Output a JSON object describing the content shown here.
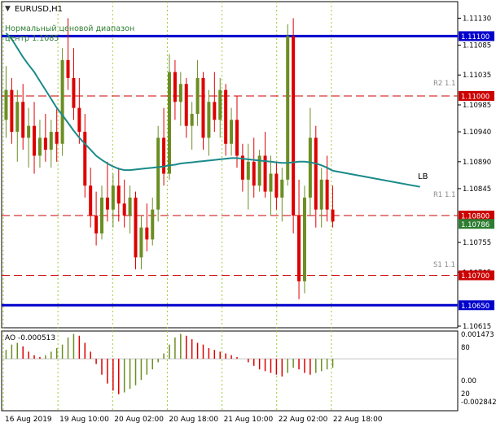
{
  "header": {
    "symbol_label": "EURUSD,H1",
    "indicator_name": "Нормальный ценовой диапазон",
    "indicator_detail": "центр 1.1085"
  },
  "right_scale": {
    "ticks": [
      "1.11130",
      "1.11085",
      "1.11035",
      "1.10985",
      "1.10940",
      "1.10890",
      "1.10845",
      "1.10755",
      "1.10705",
      "1.10615"
    ],
    "badges": [
      {
        "text": "1.11100",
        "color": "#0000cc"
      },
      {
        "text": "1.11000",
        "color": "#cc0000"
      },
      {
        "text": "1.10800",
        "color": "#cc0000"
      },
      {
        "text": "1.10786",
        "color": "#2e7d32"
      },
      {
        "text": "1.10700",
        "color": "#cc0000"
      },
      {
        "text": "1.10650",
        "color": "#0000cc"
      }
    ]
  },
  "pivot_labels": {
    "r2": "R2 1.1",
    "r1": "R1 1.1",
    "s1": "S1 1.1"
  },
  "lb_label": "LB",
  "ao_panel": {
    "label": "AO -0.000513",
    "scale_top": "0.001473",
    "scale_bottom": "-0.002842",
    "level_80": "80",
    "level_20": "20",
    "level_0": "0.00"
  },
  "time_axis": [
    "16 Aug 2019",
    "19 Aug 10:00",
    "20 Aug 02:00",
    "20 Aug 18:00",
    "21 Aug 10:00",
    "22 Aug 02:00",
    "22 Aug 18:00"
  ],
  "colors": {
    "bull": "#6b8e23",
    "bear": "#dd0000",
    "ma": "#1a8a8a",
    "level_blue": "#0000cc",
    "level_red": "#cc0000"
  },
  "chart_data": {
    "type": "candlestick",
    "symbol": "EURUSD",
    "timeframe": "H1",
    "ylim": [
      1.10615,
      1.11155
    ],
    "horizontal_levels": [
      1.111,
      1.11,
      1.108,
      1.107,
      1.1065
    ],
    "candles": [
      [
        1.1096,
        1.1105,
        1.1093,
        1.1101
      ],
      [
        1.1101,
        1.1103,
        1.1092,
        1.1094
      ],
      [
        1.1094,
        1.1101,
        1.1089,
        1.1099
      ],
      [
        1.1099,
        1.1102,
        1.1091,
        1.1093
      ],
      [
        1.1093,
        1.1098,
        1.1088,
        1.1095
      ],
      [
        1.1095,
        1.1099,
        1.1087,
        1.109
      ],
      [
        1.109,
        1.1096,
        1.1088,
        1.1093
      ],
      [
        1.1093,
        1.1097,
        1.1089,
        1.1091
      ],
      [
        1.1091,
        1.1096,
        1.1088,
        1.1094
      ],
      [
        1.1094,
        1.1098,
        1.1089,
        1.1092
      ],
      [
        1.1092,
        1.1108,
        1.109,
        1.1106
      ],
      [
        1.1106,
        1.1113,
        1.1101,
        1.1103
      ],
      [
        1.1103,
        1.1108,
        1.1096,
        1.1098
      ],
      [
        1.1098,
        1.1103,
        1.1092,
        1.1094
      ],
      [
        1.1094,
        1.1097,
        1.1083,
        1.1085
      ],
      [
        1.1085,
        1.1088,
        1.1078,
        1.108
      ],
      [
        1.108,
        1.1084,
        1.1075,
        1.1077
      ],
      [
        1.1077,
        1.1085,
        1.1076,
        1.1083
      ],
      [
        1.1083,
        1.1089,
        1.1079,
        1.1081
      ],
      [
        1.1081,
        1.1087,
        1.1078,
        1.1085
      ],
      [
        1.1085,
        1.1088,
        1.1079,
        1.1082
      ],
      [
        1.1082,
        1.1086,
        1.1078,
        1.108
      ],
      [
        1.108,
        1.1085,
        1.1077,
        1.1083
      ],
      [
        1.1083,
        1.1084,
        1.1071,
        1.1073
      ],
      [
        1.1073,
        1.108,
        1.1071,
        1.1078
      ],
      [
        1.1078,
        1.1082,
        1.1074,
        1.1076
      ],
      [
        1.1076,
        1.1083,
        1.1075,
        1.1081
      ],
      [
        1.1081,
        1.1095,
        1.1079,
        1.1093
      ],
      [
        1.1093,
        1.1098,
        1.1085,
        1.1087
      ],
      [
        1.1087,
        1.1107,
        1.1086,
        1.1104
      ],
      [
        1.1104,
        1.1106,
        1.1096,
        1.1099
      ],
      [
        1.1099,
        1.1104,
        1.1095,
        1.1102
      ],
      [
        1.1102,
        1.1103,
        1.1093,
        1.1095
      ],
      [
        1.1095,
        1.1099,
        1.1091,
        1.1097
      ],
      [
        1.1097,
        1.1106,
        1.1095,
        1.1103
      ],
      [
        1.1103,
        1.1104,
        1.1091,
        1.1093
      ],
      [
        1.1093,
        1.1101,
        1.109,
        1.1099
      ],
      [
        1.1099,
        1.1104,
        1.1094,
        1.1096
      ],
      [
        1.1096,
        1.1103,
        1.1093,
        1.1101
      ],
      [
        1.1101,
        1.1102,
        1.109,
        1.1092
      ],
      [
        1.1092,
        1.1098,
        1.109,
        1.1096
      ],
      [
        1.1096,
        1.11,
        1.1088,
        1.109
      ],
      [
        1.109,
        1.1092,
        1.1084,
        1.1086
      ],
      [
        1.1086,
        1.1092,
        1.1081,
        1.1089
      ],
      [
        1.1089,
        1.1093,
        1.1083,
        1.1085
      ],
      [
        1.1085,
        1.1091,
        1.1084,
        1.109
      ],
      [
        1.109,
        1.1094,
        1.1083,
        1.1084
      ],
      [
        1.1084,
        1.109,
        1.108,
        1.1087
      ],
      [
        1.1087,
        1.1089,
        1.1081,
        1.1083
      ],
      [
        1.1083,
        1.1088,
        1.1079,
        1.1086
      ],
      [
        1.1086,
        1.1112,
        1.1085,
        1.111
      ],
      [
        1.111,
        1.1113,
        1.1077,
        1.108
      ],
      [
        1.108,
        1.1086,
        1.1066,
        1.1069
      ],
      [
        1.1069,
        1.1085,
        1.1067,
        1.1083
      ],
      [
        1.1083,
        1.1098,
        1.108,
        1.1093
      ],
      [
        1.1093,
        1.1095,
        1.1078,
        1.1081
      ],
      [
        1.1081,
        1.1088,
        1.1078,
        1.1086
      ],
      [
        1.1086,
        1.109,
        1.1079,
        1.1081
      ],
      [
        1.1081,
        1.1085,
        1.1078,
        1.1079
      ]
    ],
    "moving_average": [
      1.11105,
      1.11095,
      1.1108,
      1.11065,
      1.11052,
      1.1104,
      1.11025,
      1.1101,
      1.10995,
      1.1098,
      1.10968,
      1.10955,
      1.10942,
      1.1093,
      1.1092,
      1.1091,
      1.109,
      1.10893,
      1.10887,
      1.10882,
      1.10878,
      1.10876,
      1.10876,
      1.10877,
      1.10878,
      1.10879,
      1.1088,
      1.10881,
      1.10882,
      1.10884,
      1.10885,
      1.10887,
      1.10888,
      1.10889,
      1.1089,
      1.10891,
      1.10892,
      1.10893,
      1.10894,
      1.10895,
      1.10896,
      1.10896,
      1.10895,
      1.10894,
      1.10893,
      1.10892,
      1.10891,
      1.1089,
      1.10889,
      1.10888,
      1.10888,
      1.10889,
      1.1089,
      1.1089,
      1.10889,
      1.10887,
      1.10884,
      1.1088,
      1.10875
    ],
    "ao_values": [
      0.0005,
      0.0008,
      0.0009,
      0.0007,
      0.0004,
      0.0002,
      0.0001,
      0.0002,
      0.0004,
      0.0006,
      0.0008,
      0.0012,
      0.0014,
      0.0013,
      0.0009,
      0.0004,
      -0.0003,
      -0.0009,
      -0.0014,
      -0.0018,
      -0.002,
      -0.0019,
      -0.0017,
      -0.0015,
      -0.0012,
      -0.0009,
      -0.0006,
      -0.0002,
      0.0003,
      0.0008,
      0.0012,
      0.0014,
      0.0013,
      0.0011,
      0.0009,
      0.0008,
      0.0006,
      0.0005,
      0.0004,
      0.0003,
      0.0002,
      0.0001,
      0.0,
      -0.0002,
      -0.0004,
      -0.0006,
      -0.0007,
      -0.0008,
      -0.0009,
      -0.001,
      -0.0008,
      -0.0005,
      -0.0006,
      -0.0008,
      -0.0009,
      -0.0008,
      -0.0007,
      -0.0006,
      -0.0005
    ],
    "ao_ylim": [
      -0.002842,
      0.001473
    ]
  }
}
